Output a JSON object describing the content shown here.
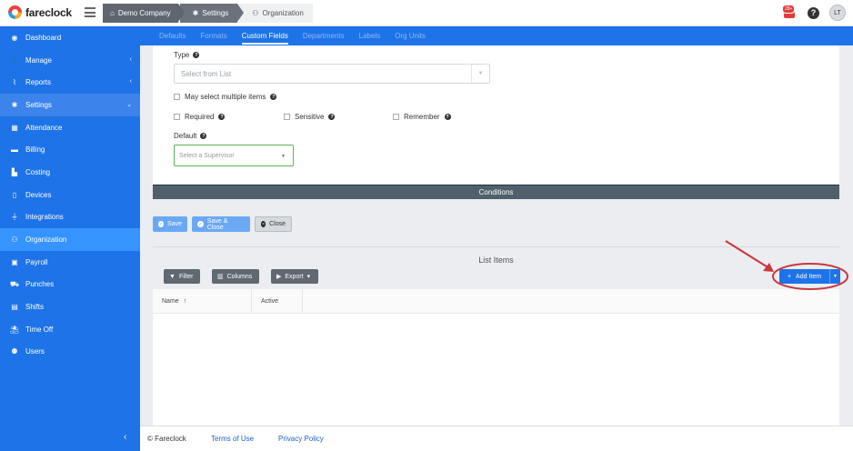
{
  "app": {
    "brand": "fareclock",
    "breadcrumbs": [
      "Demo Company",
      "Settings",
      "Organization"
    ],
    "notifications_badge": "28+",
    "help_glyph": "?",
    "user_initials": "LT"
  },
  "sidebar": {
    "items": [
      {
        "label": "Dashboard",
        "icon": "dashboard-icon",
        "glyph": "◉"
      },
      {
        "label": "Manage",
        "icon": "user-icon",
        "glyph": "👤",
        "arrow": "‹"
      },
      {
        "label": "Reports",
        "icon": "chart-icon",
        "glyph": "⌇",
        "arrow": "‹"
      },
      {
        "label": "Settings",
        "icon": "gear-icon",
        "glyph": "✱",
        "arrow": "⌄"
      },
      {
        "label": "Attendance",
        "icon": "attendance-icon",
        "glyph": "▦"
      },
      {
        "label": "Billing",
        "icon": "credit-card-icon",
        "glyph": "▬"
      },
      {
        "label": "Costing",
        "icon": "folder-icon",
        "glyph": "▙"
      },
      {
        "label": "Devices",
        "icon": "tablet-icon",
        "glyph": "▯"
      },
      {
        "label": "Integrations",
        "icon": "plug-icon",
        "glyph": "⏚"
      },
      {
        "label": "Organization",
        "icon": "org-chart-icon",
        "glyph": "⚇"
      },
      {
        "label": "Payroll",
        "icon": "money-icon",
        "glyph": "▣"
      },
      {
        "label": "Punches",
        "icon": "car-icon",
        "glyph": "⛟"
      },
      {
        "label": "Shifts",
        "icon": "calendar-icon",
        "glyph": "▤"
      },
      {
        "label": "Time Off",
        "icon": "beach-umbrella-icon",
        "glyph": "⛱"
      },
      {
        "label": "Users",
        "icon": "users-icon",
        "glyph": "⚉"
      }
    ],
    "collapse_glyph": "‹"
  },
  "subnav": {
    "tabs": [
      "Defaults",
      "Formats",
      "Custom Fields",
      "Departments",
      "Labels",
      "Org Units"
    ],
    "active": "Custom Fields"
  },
  "form": {
    "type_label": "Type",
    "type_placeholder": "Select from List",
    "multiple_label": "May select multiple items",
    "required_label": "Required",
    "sensitive_label": "Sensitive",
    "remember_label": "Remember",
    "default_label": "Default",
    "default_placeholder": "Select a Supervisor",
    "conditions_label": "Conditions"
  },
  "actions": {
    "save": "Save",
    "save_close": "Save & Close",
    "close": "Close"
  },
  "list": {
    "title": "List Items",
    "filter": "Filter",
    "columns": "Columns",
    "export": "Export",
    "add_item": "Add Item",
    "col_name": "Name",
    "col_active": "Active"
  },
  "footer": {
    "copyright": "© Fareclock",
    "terms": "Terms of Use",
    "privacy": "Privacy Policy"
  },
  "colors": {
    "primary": "#1e73e8",
    "active_nav": "#3594ff",
    "conditions_bar": "#4f606b",
    "annotation": "#c8383d"
  }
}
